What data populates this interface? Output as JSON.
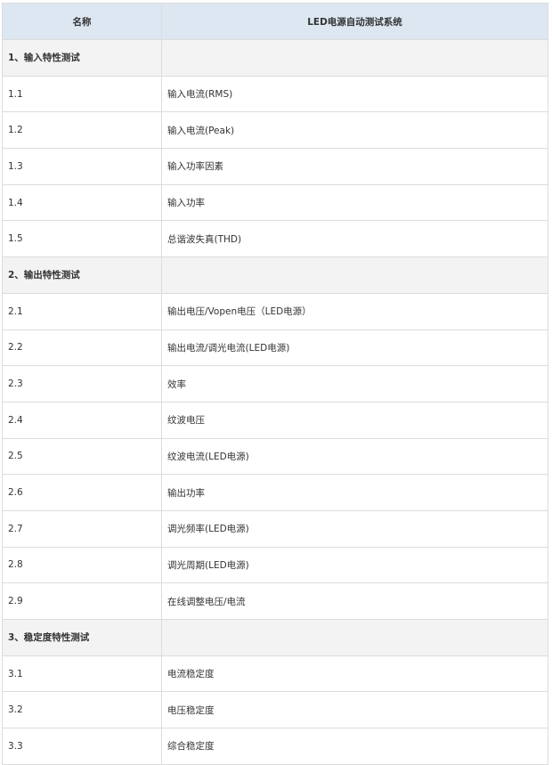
{
  "table": {
    "header": {
      "col_name": "名称",
      "col_system": "LED电源自动测试系统"
    },
    "rows": [
      {
        "type": "section",
        "id": "1、输入特性测试",
        "item": ""
      },
      {
        "type": "item",
        "id": "1.1",
        "item": "输入电流(RMS)"
      },
      {
        "type": "item",
        "id": "1.2",
        "item": "输入电流(Peak)"
      },
      {
        "type": "item",
        "id": "1.3",
        "item": "输入功率因素"
      },
      {
        "type": "item",
        "id": "1.4",
        "item": "输入功率"
      },
      {
        "type": "item",
        "id": "1.5",
        "item": "总谐波失真(THD)"
      },
      {
        "type": "section",
        "id": "2、输出特性测试",
        "item": ""
      },
      {
        "type": "item",
        "id": "2.1",
        "item": "输出电压/Vopen电压（LED电源）"
      },
      {
        "type": "item",
        "id": "2.2",
        "item": "输出电流/调光电流(LED电源)"
      },
      {
        "type": "item",
        "id": "2.3",
        "item": "效率"
      },
      {
        "type": "item",
        "id": "2.4",
        "item": "纹波电压"
      },
      {
        "type": "item",
        "id": "2.5",
        "item": "纹波电流(LED电源)"
      },
      {
        "type": "item",
        "id": "2.6",
        "item": "输出功率"
      },
      {
        "type": "item",
        "id": "2.7",
        "item": "调光频率(LED电源)"
      },
      {
        "type": "item",
        "id": "2.8",
        "item": "调光周期(LED电源)"
      },
      {
        "type": "item",
        "id": "2.9",
        "item": "在线调整电压/电流"
      },
      {
        "type": "section",
        "id": "3、稳定度特性测试",
        "item": ""
      },
      {
        "type": "item",
        "id": "3.1",
        "item": "电流稳定度"
      },
      {
        "type": "item",
        "id": "3.2",
        "item": "电压稳定度"
      },
      {
        "type": "item",
        "id": "3.3",
        "item": "综合稳定度"
      }
    ]
  },
  "colors": {
    "header_bg": "#dde7f2",
    "section_bg": "#f3f3f3",
    "border": "#dcdcdc",
    "text": "#333333"
  }
}
